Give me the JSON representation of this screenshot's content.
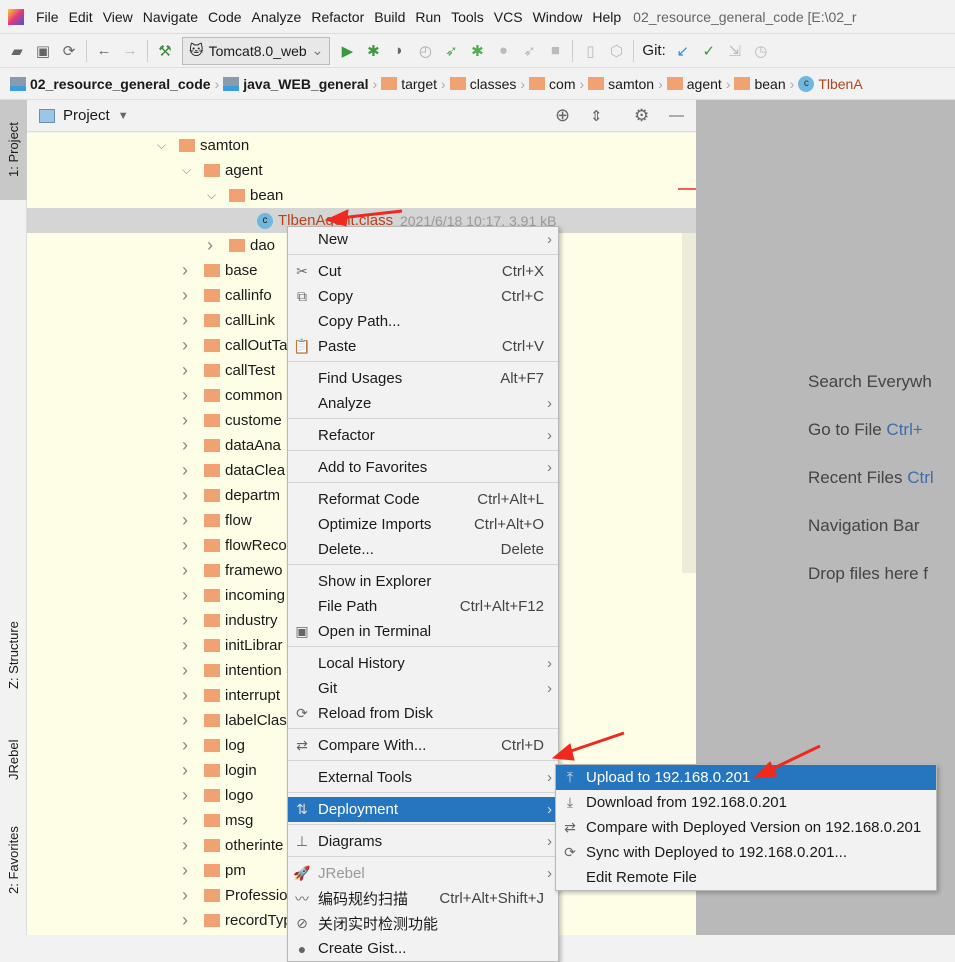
{
  "menubar": {
    "items": [
      "File",
      "Edit",
      "View",
      "Navigate",
      "Code",
      "Analyze",
      "Refactor",
      "Build",
      "Run",
      "Tools",
      "VCS",
      "Window",
      "Help"
    ],
    "title": "02_resource_general_code [E:\\02_r"
  },
  "toolbar": {
    "run_config": "Tomcat8.0_web",
    "git_label": "Git:"
  },
  "breadcrumbs": [
    {
      "label": "02_resource_general_code",
      "type": "module",
      "bold": true
    },
    {
      "label": "java_WEB_general",
      "type": "module",
      "bold": true
    },
    {
      "label": "target",
      "type": "folder"
    },
    {
      "label": "classes",
      "type": "folder"
    },
    {
      "label": "com",
      "type": "folder"
    },
    {
      "label": "samton",
      "type": "folder"
    },
    {
      "label": "agent",
      "type": "folder"
    },
    {
      "label": "bean",
      "type": "folder"
    },
    {
      "label": "TlbenA",
      "type": "class"
    }
  ],
  "side_tabs": {
    "project": "1: Project",
    "structure": "Z: Structure",
    "jrebel": "JRebel",
    "favorites": "2: Favorites"
  },
  "project_panel": {
    "title": "Project"
  },
  "tree": [
    {
      "label": "samton",
      "level": 0,
      "expanded": true
    },
    {
      "label": "agent",
      "level": 1,
      "expanded": true
    },
    {
      "label": "bean",
      "level": 2,
      "expanded": true
    },
    {
      "label": "TlbenAgent.class",
      "level": 3,
      "file": true,
      "meta": "2021/6/18 10:17, 3.91 kB",
      "selected": true
    },
    {
      "label": "dao",
      "level": 2
    },
    {
      "label": "base",
      "level": 1
    },
    {
      "label": "callinfo",
      "level": 1
    },
    {
      "label": "callLink",
      "level": 1
    },
    {
      "label": "callOutTa",
      "level": 1
    },
    {
      "label": "callTest",
      "level": 1
    },
    {
      "label": "common",
      "level": 1
    },
    {
      "label": "custome",
      "level": 1
    },
    {
      "label": "dataAna",
      "level": 1
    },
    {
      "label": "dataClea",
      "level": 1
    },
    {
      "label": "departm",
      "level": 1
    },
    {
      "label": "flow",
      "level": 1
    },
    {
      "label": "flowReco",
      "level": 1
    },
    {
      "label": "framewo",
      "level": 1
    },
    {
      "label": "incoming",
      "level": 1
    },
    {
      "label": "industry",
      "level": 1
    },
    {
      "label": "initLibrar",
      "level": 1
    },
    {
      "label": "intention",
      "level": 1
    },
    {
      "label": "interrupt",
      "level": 1
    },
    {
      "label": "labelClas",
      "level": 1
    },
    {
      "label": "log",
      "level": 1
    },
    {
      "label": "login",
      "level": 1
    },
    {
      "label": "logo",
      "level": 1
    },
    {
      "label": "msg",
      "level": 1
    },
    {
      "label": "otherinte",
      "level": 1
    },
    {
      "label": "pm",
      "level": 1
    },
    {
      "label": "Professio",
      "level": 1
    },
    {
      "label": "recordTyp",
      "level": 1
    }
  ],
  "editor_hints": [
    {
      "text": "Search Everywh",
      "key": ""
    },
    {
      "text": "Go to File ",
      "key": "Ctrl+"
    },
    {
      "text": "Recent Files ",
      "key": "Ctrl"
    },
    {
      "text": "Navigation Bar",
      "key": ""
    },
    {
      "text": "Drop files here f",
      "key": ""
    }
  ],
  "context_menu": [
    {
      "label": "New",
      "sub": true
    },
    {
      "sep": true
    },
    {
      "label": "Cut",
      "shortcut": "Ctrl+X",
      "icon": "✂"
    },
    {
      "label": "Copy",
      "shortcut": "Ctrl+C",
      "icon": "⧉"
    },
    {
      "label": "Copy Path..."
    },
    {
      "label": "Paste",
      "shortcut": "Ctrl+V",
      "icon": "📋"
    },
    {
      "sep": true
    },
    {
      "label": "Find Usages",
      "shortcut": "Alt+F7"
    },
    {
      "label": "Analyze",
      "sub": true
    },
    {
      "sep": true
    },
    {
      "label": "Refactor",
      "sub": true
    },
    {
      "sep": true
    },
    {
      "label": "Add to Favorites",
      "sub": true
    },
    {
      "sep": true
    },
    {
      "label": "Reformat Code",
      "shortcut": "Ctrl+Alt+L"
    },
    {
      "label": "Optimize Imports",
      "shortcut": "Ctrl+Alt+O"
    },
    {
      "label": "Delete...",
      "shortcut": "Delete"
    },
    {
      "sep": true
    },
    {
      "label": "Show in Explorer"
    },
    {
      "label": "File Path",
      "shortcut": "Ctrl+Alt+F12"
    },
    {
      "label": "Open in Terminal",
      "icon": "▣"
    },
    {
      "sep": true
    },
    {
      "label": "Local History",
      "sub": true
    },
    {
      "label": "Git",
      "sub": true
    },
    {
      "label": "Reload from Disk",
      "icon": "⟳"
    },
    {
      "sep": true
    },
    {
      "label": "Compare With...",
      "shortcut": "Ctrl+D",
      "icon": "⇄"
    },
    {
      "sep": true
    },
    {
      "label": "External Tools",
      "sub": true
    },
    {
      "sep": true
    },
    {
      "label": "Deployment",
      "sub": true,
      "icon": "⇅",
      "highlighted": true
    },
    {
      "sep": true
    },
    {
      "label": "Diagrams",
      "sub": true,
      "icon": "⊥"
    },
    {
      "sep": true
    },
    {
      "label": "JRebel",
      "sub": true,
      "disabled": true,
      "icon": "🚀"
    },
    {
      "label": "编码规约扫描",
      "shortcut": "Ctrl+Alt+Shift+J",
      "icon": "〰"
    },
    {
      "label": "关闭实时检测功能",
      "icon": "⊘"
    },
    {
      "label": "Create Gist...",
      "icon": "●"
    }
  ],
  "deployment_submenu": [
    {
      "label": "Upload to 192.168.0.201",
      "icon": "⤒",
      "highlighted": true
    },
    {
      "label": "Download from 192.168.0.201",
      "icon": "⤓"
    },
    {
      "label": "Compare with Deployed Version on 192.168.0.201",
      "icon": "⇄"
    },
    {
      "label": "Sync with Deployed to 192.168.0.201...",
      "icon": "⟳"
    },
    {
      "label": "Edit Remote File"
    }
  ],
  "colors": {
    "selection": "#2675bf",
    "tree_bg": "#fefee6",
    "folder": "#f0a273",
    "annotation_arrow": "#f0281e",
    "class_file_text": "#b5431e"
  }
}
